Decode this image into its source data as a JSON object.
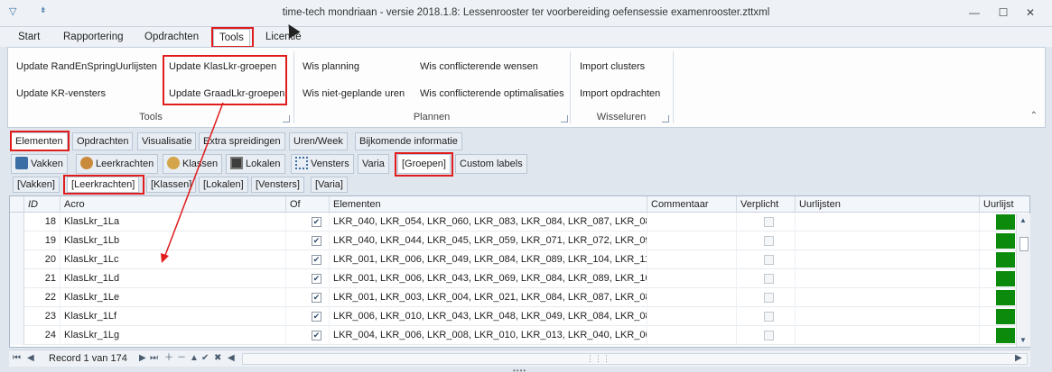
{
  "window": {
    "title": "time-tech mondriaan - versie 2018.1.8: Lessenrooster ter voorbereiding oefensessie examenrooster.zttxml",
    "min_glyph": "—",
    "max_glyph": "☐",
    "close_glyph": "✕"
  },
  "menu": {
    "tabs": [
      {
        "label": "Start"
      },
      {
        "label": "Rapportering"
      },
      {
        "label": "Opdrachten"
      },
      {
        "label": "Tools"
      },
      {
        "label": "Licentie"
      }
    ]
  },
  "ribbon": {
    "groups": [
      {
        "label": "Tools",
        "items": [
          "Update RandEnSpringUurlijsten",
          "Update KR-vensters",
          "Update KlasLkr-groepen",
          "Update GraadLkr-groepen"
        ]
      },
      {
        "label": "Plannen",
        "items": [
          "Wis planning",
          "Wis niet-geplande uren",
          "Wis conflicterende wensen",
          "Wis conflicterende optimalisaties"
        ]
      },
      {
        "label": "Wisseluren",
        "items": [
          "Import clusters",
          "Import opdrachten"
        ]
      }
    ]
  },
  "tabs_level1": [
    "Elementen",
    "Opdrachten",
    "Visualisatie",
    "Extra spreidingen",
    "Uren/Week",
    "Bijkomende informatie"
  ],
  "tabs_level2": [
    "Vakken",
    "Leerkrachten",
    "Klassen",
    "Lokalen",
    "Vensters",
    "Varia",
    "[Groepen]",
    "Custom labels"
  ],
  "tabs_level3": [
    "[Vakken]",
    "[Leerkrachten]",
    "[Klassen]",
    "[Lokalen]",
    "[Vensters]",
    "[Varia]"
  ],
  "grid": {
    "columns": [
      "ID",
      "Acro",
      "Of",
      "Elementen",
      "Commentaar",
      "Verplicht",
      "Uurlijsten",
      "Uurlijst"
    ],
    "rows": [
      {
        "id": "18",
        "acro": "KlasLkr_1La",
        "elementen": "LKR_040, LKR_054, LKR_060, LKR_083, LKR_084, LKR_087, LKR_08",
        "of": true
      },
      {
        "id": "19",
        "acro": "KlasLkr_1Lb",
        "elementen": "LKR_040, LKR_044, LKR_045, LKR_059, LKR_071, LKR_072, LKR_09",
        "of": true
      },
      {
        "id": "20",
        "acro": "KlasLkr_1Lc",
        "elementen": "LKR_001, LKR_006, LKR_049, LKR_084, LKR_089, LKR_104, LKR_11",
        "of": true
      },
      {
        "id": "21",
        "acro": "KlasLkr_1Ld",
        "elementen": "LKR_001, LKR_006, LKR_043, LKR_069, LKR_084, LKR_089, LKR_10",
        "of": true
      },
      {
        "id": "22",
        "acro": "KlasLkr_1Le",
        "elementen": "LKR_001, LKR_003, LKR_004, LKR_021, LKR_084, LKR_087, LKR_08",
        "of": true
      },
      {
        "id": "23",
        "acro": "KlasLkr_1Lf",
        "elementen": "LKR_006, LKR_010, LKR_043, LKR_048, LKR_049, LKR_084, LKR_08",
        "of": true
      },
      {
        "id": "24",
        "acro": "KlasLkr_1Lg",
        "elementen": "LKR_004, LKR_006, LKR_008, LKR_010, LKR_013, LKR_040, LKR_06",
        "of": true
      }
    ],
    "uurlijst_color": "#0b8a0b"
  },
  "navigator": {
    "record_text": "Record 1 van 174"
  },
  "colors": {
    "highlight": "#e01c1c",
    "accent": "#3b6ea5"
  }
}
